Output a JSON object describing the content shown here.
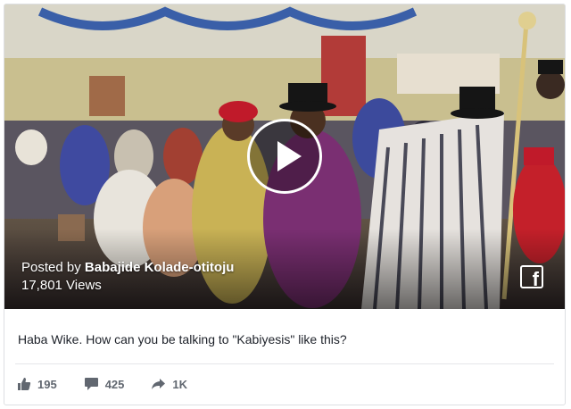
{
  "post": {
    "posted_prefix": "Posted by",
    "author": "Babajide Kolade-otitoju",
    "views": "17,801 Views",
    "caption": "Haba Wike. How can you be talking to \"Kabiyesis\" like this?"
  },
  "actions": {
    "likes": "195",
    "comments": "425",
    "shares": "1K"
  },
  "icons": {
    "play": "play-icon",
    "facebook": "facebook-icon",
    "like": "thumbs-up-icon",
    "comment": "comment-icon",
    "share": "share-arrow-icon"
  },
  "colors": {
    "text": "#1d2129",
    "muted": "#616770",
    "border": "#dddfe2"
  }
}
